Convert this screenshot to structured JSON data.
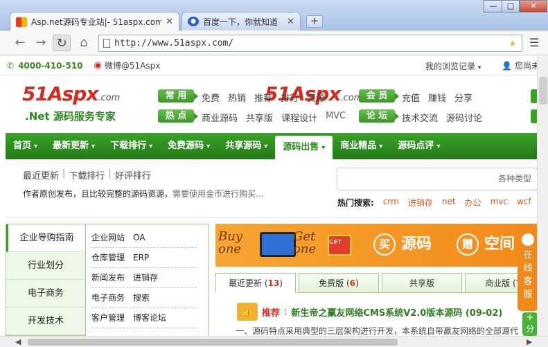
{
  "browser": {
    "tabs": [
      {
        "title": "Asp.net源码专业站|- 51aspx.com",
        "active": true
      },
      {
        "title": "百度一下，你就知道",
        "active": false
      }
    ],
    "url": "http://www.51aspx.com/",
    "newtab_label": "+",
    "window_controls": {
      "min": "—",
      "max": "□",
      "close": "✕"
    }
  },
  "topbar": {
    "phone": "4000-410-510",
    "weibo": "微博@51Aspx",
    "history": "我的浏览记录",
    "user": "您尚未"
  },
  "logo": {
    "main_a": "51",
    "main_b": "Aspx",
    "domain": ".com",
    "slogan": ".Net 源码服务专家"
  },
  "categories": [
    {
      "label": "常 用",
      "links": [
        "免费",
        "热销",
        "推荐",
        "排行",
        "资源"
      ]
    },
    {
      "label": "热 点",
      "links": [
        "商业源码",
        "共享版",
        "课程设计",
        "MVC"
      ]
    },
    {
      "label": "会 员",
      "links": [
        "充值",
        "赚钱",
        "分享"
      ]
    },
    {
      "label": "论 坛",
      "links": [
        "技术交流",
        "源码讨论"
      ]
    }
  ],
  "nav": {
    "items": [
      "首页",
      "最新更新",
      "下载排行",
      "免费源码",
      "共享源码",
      "源码出售",
      "商业精品",
      "源码点评"
    ],
    "active_index": 5
  },
  "subnav": {
    "links": [
      "最近更新",
      "下载排行",
      "好评排行"
    ],
    "desc_main": "作者原创发布，且比较完整的源码资源，",
    "desc_tail": "需要使用金币进行购买..."
  },
  "search": {
    "placeholder": "各种类型",
    "hot_label": "热门搜索:",
    "hot_keywords": [
      "crm",
      "进销存",
      "net",
      "办公",
      "mvc",
      "wcf"
    ]
  },
  "leftnav": {
    "items": [
      "企业导购指南",
      "行业划分",
      "电子商务",
      "开发技术"
    ],
    "active_index": 0
  },
  "linkgrid": [
    [
      "企业网站",
      "OA"
    ],
    [
      "仓库管理",
      "ERP"
    ],
    [
      "新闻发布",
      "进销存"
    ],
    [
      "电子商务",
      "搜索"
    ],
    [
      "客户管理",
      "博客论坛"
    ]
  ],
  "banner": {
    "buy": "Buy",
    "buy_sub": "one",
    "get": "Get",
    "get_sub": "one",
    "gift": "GIFT",
    "c1": "买",
    "t1": "源码",
    "c2": "赠",
    "t2": "空间"
  },
  "content_tabs": [
    {
      "label": "最近更新",
      "count": "13",
      "active": true
    },
    {
      "label": "免费版",
      "count": "6",
      "active": false
    },
    {
      "label": "共享版",
      "count": "",
      "active": false
    },
    {
      "label": "商业版",
      "count": "7",
      "active": false
    }
  ],
  "news": {
    "badge": "推荐",
    "title": "新生帝之赢友网络CMS系统V2.0版本源码 (09-02)",
    "snippet": "一、源码特点采用典型的三层架构进行开发，本系统自带赢友网络的全部源代"
  },
  "qq_widget": {
    "text": "在线客服"
  },
  "share_widget": {
    "label": "分"
  }
}
